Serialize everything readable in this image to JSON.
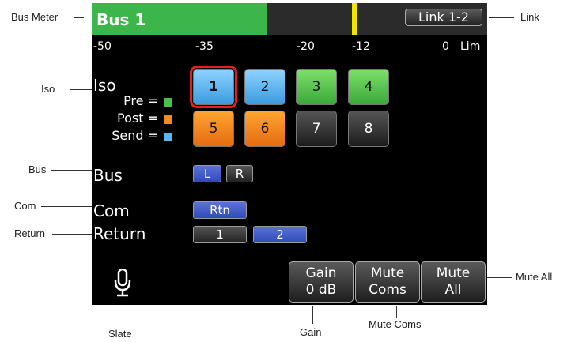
{
  "callouts": {
    "bus_meter": "Bus Meter",
    "link": "Link",
    "iso": "Iso",
    "bus": "Bus",
    "com": "Com",
    "return": "Return",
    "mute_all": "Mute All",
    "slate": "Slate",
    "gain": "Gain",
    "mute_coms": "Mute Coms"
  },
  "screen": {
    "title": "Bus 1",
    "link_button": "Link 1-2",
    "meter": {
      "level_fraction": 0.44,
      "peak_label": "-12",
      "fill_color": "#3cb64a",
      "peak_color": "#f1e500"
    },
    "scale": [
      "-50",
      "-35",
      "-20",
      "-12",
      "0",
      "Lim"
    ],
    "iso": {
      "label": "Iso",
      "legend": [
        "Pre =",
        "Post =",
        "Send ="
      ],
      "legend_colors": [
        "#4cc04c",
        "#f08c1e",
        "#5ab4f0"
      ],
      "buttons": [
        "1",
        "2",
        "3",
        "4",
        "5",
        "6",
        "7",
        "8"
      ],
      "selected": "1"
    },
    "bus": {
      "label": "Bus",
      "left": "L",
      "right": "R"
    },
    "com": {
      "label": "Com",
      "rtn": "Rtn"
    },
    "return": {
      "label": "Return",
      "one": "1",
      "two": "2"
    },
    "gain": {
      "line1": "Gain",
      "line2": "0 dB"
    },
    "mute_coms": {
      "line1": "Mute",
      "line2": "Coms"
    },
    "mute_all": {
      "line1": "Mute",
      "line2": "All"
    },
    "slate_icon": "microphone-icon"
  }
}
